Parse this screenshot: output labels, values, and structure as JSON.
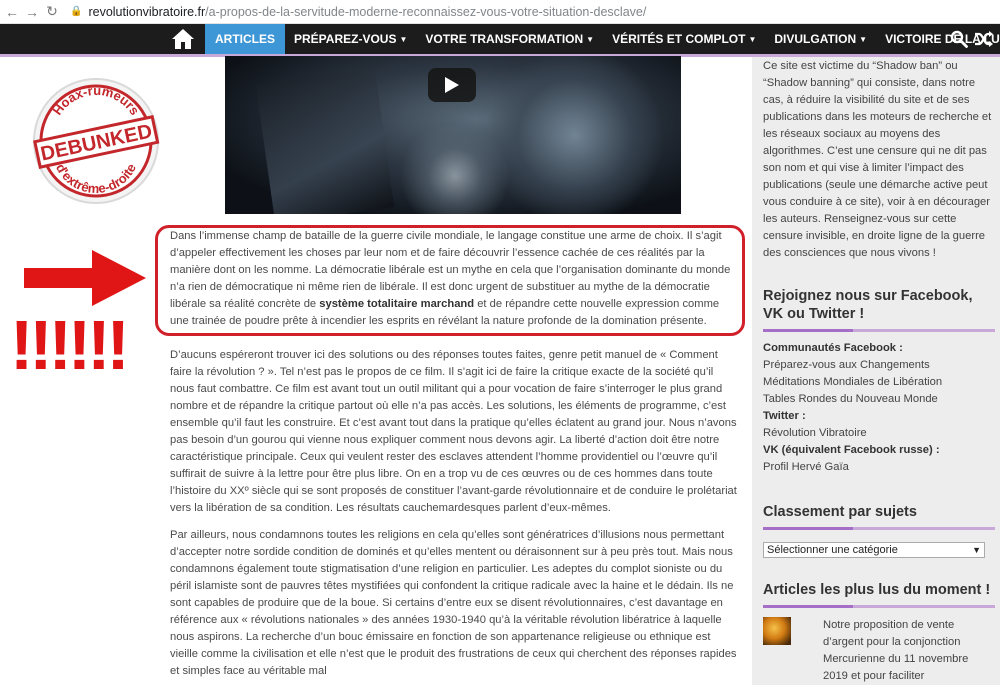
{
  "browser": {
    "url_host": "revolutionvibratoire.fr",
    "url_path": "/a-propos-de-la-servitude-moderne-reconnaissez-vous-votre-situation-desclave/"
  },
  "nav": {
    "items": [
      {
        "label": "ARTICLES",
        "active": true,
        "dropdown": false
      },
      {
        "label": "PRÉPAREZ-VOUS",
        "active": false,
        "dropdown": true
      },
      {
        "label": "VOTRE TRANSFORMATION",
        "active": false,
        "dropdown": true
      },
      {
        "label": "VÉRITÉS ET COMPLOT",
        "active": false,
        "dropdown": true
      },
      {
        "label": "DIVULGATION",
        "active": false,
        "dropdown": true
      },
      {
        "label": "VICTOIRE DE LA LUMIÈRE",
        "active": false,
        "dropdown": true
      }
    ],
    "icons": [
      "home-icon",
      "search-icon",
      "shuffle-icon"
    ],
    "accent": "#3d96d6",
    "underline_color": "#c8a7d9"
  },
  "stamp": {
    "top": "Hoax-rumeurs",
    "middle": "DEBUNKED",
    "bottom": "d'extrême-droite"
  },
  "exclamation": "!!!!!!",
  "annotation_color": "#e01515",
  "article": {
    "p1_a": "Dans l’immense champ de bataille de la guerre civile mondiale, le langage constitue une arme de choix. Il s’agit d’appeler effectivement les choses par leur nom et de faire découvrir l’essence cachée de ces réalités par la manière dont on les nomme. La démocratie libérale est un mythe en cela que l’organisation dominante du monde n’a rien de démocratique ni même rien de libérale. Il est donc urgent de substituer au mythe de la démocratie libérale sa réalité concrète de ",
    "p1_bold": "système totalitaire marchand",
    "p1_b": " et de répandre cette nouvelle expression comme une trainée de poudre prête à incendier les esprits en révélant la nature profonde de la domination présente.",
    "p2": "D’aucuns espéreront trouver ici des solutions ou des réponses toutes faites, genre petit manuel de « Comment faire la révolution ? ». Tel n’est pas le propos de ce film. Il s’agit ici de faire la critique exacte de la société qu’il nous faut combattre. Ce film est avant tout un outil militant qui a pour vocation de faire s’interroger le plus grand nombre et de répandre la critique partout où elle n’a pas accès. Les solutions, les éléments de programme, c’est ensemble qu’il faut les construire. Et c’est avant tout dans la pratique qu’elles éclatent au grand jour. Nous n’avons pas besoin d’un gourou qui vienne nous expliquer comment nous devons agir. La liberté d’action doit être notre caractéristique principale. Ceux qui veulent rester des esclaves attendent l’homme providentiel ou l’œuvre qu’il suffirait de suivre à la lettre pour être plus libre. On en a trop vu de ces œuvres ou de ces hommes dans toute l’histoire du XXº siècle qui se sont proposés de constituer l’avant-garde révolutionnaire et de conduire le prolétariat vers la libération de sa condition. Les résultats cauchemardesques parlent d’eux-mêmes.",
    "p3": "Par ailleurs, nous condamnons toutes les religions en cela qu’elles sont génératrices d’illusions nous permettant d’accepter notre sordide condition de dominés et qu’elles mentent ou déraisonnent sur à peu près tout. Mais nous condamnons également toute stigmatisation d’une religion en particulier. Les adeptes du complot sioniste ou du péril islamiste sont de pauvres têtes mystifiées qui confondent la critique radicale avec la haine et le dédain. Ils ne sont capables de produire que de la boue. Si certains d’entre eux se disent révolutionnaires, c’est davantage en référence aux « révolutions nationales » des années 1930-1940 qu’à la véritable révolution libératrice à laquelle nous aspirons. La recherche d’un bouc émissaire en fonction de son appartenance religieuse ou ethnique est vieille comme la civilisation et elle n’est que le produit des frustrations de ceux qui cherchent des réponses rapides et simples face au véritable mal"
  },
  "sidebar": {
    "shadowban_text": "Ce site est victime du “Shadow ban” ou “Shadow banning” qui consiste, dans notre cas, à réduire la visibilité du site et de ses publications dans les moteurs de recherche et les réseaux sociaux au moyens des algorithmes. C’est une censure qui ne dit pas son nom et qui vise à limiter l’impact des publications (seule une démarche active peut vous conduire à ce site), voir à en décourager les auteurs. Renseignez-vous sur cette censure invisible, en droite ligne de la guerre des consciences que nous vivons !",
    "fb_heading": "Rejoignez nous sur Facebook, VK ou Twitter !",
    "fb_label": "Communautés Facebook :",
    "fb_links": [
      "Préparez-vous aux Changements",
      "Méditations Mondiales de Libération",
      "Tables Rondes du Nouveau Monde"
    ],
    "twitter_label": "Twitter :",
    "twitter_link": "Révolution Vibratoire",
    "vk_label": "VK (équivalent Facebook russe) :",
    "vk_link": "Profil Hervé Gaïa",
    "cat_heading": "Classement par sujets",
    "cat_select": "Sélectionner une catégorie",
    "pop_heading": "Articles les plus lus du moment !",
    "pop_item": "Notre proposition de vente d’argent pour la conjonction Mercurienne du 11 novembre 2019 et pour faciliter"
  }
}
